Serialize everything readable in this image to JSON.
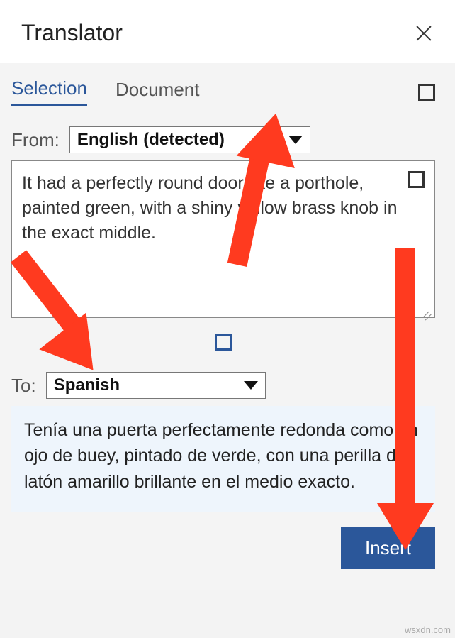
{
  "header": {
    "title": "Translator"
  },
  "tabs": {
    "selection": "Selection",
    "document": "Document"
  },
  "from": {
    "label": "From:",
    "value": "English (detected)"
  },
  "source_text": "It had a perfectly round door like a porthole, painted green, with a shiny yellow brass knob in the exact middle.",
  "to": {
    "label": "To:",
    "value": "Spanish"
  },
  "output_text": "Tenía una puerta perfectamente redonda como un ojo de buey, pintado de verde, con una perilla de latón amarillo brillante en el medio exacto.",
  "buttons": {
    "insert": "Insert"
  },
  "watermark": "wsxdn.com",
  "accent_color": "#2b579a",
  "annotation_color": "#ff3a1f"
}
